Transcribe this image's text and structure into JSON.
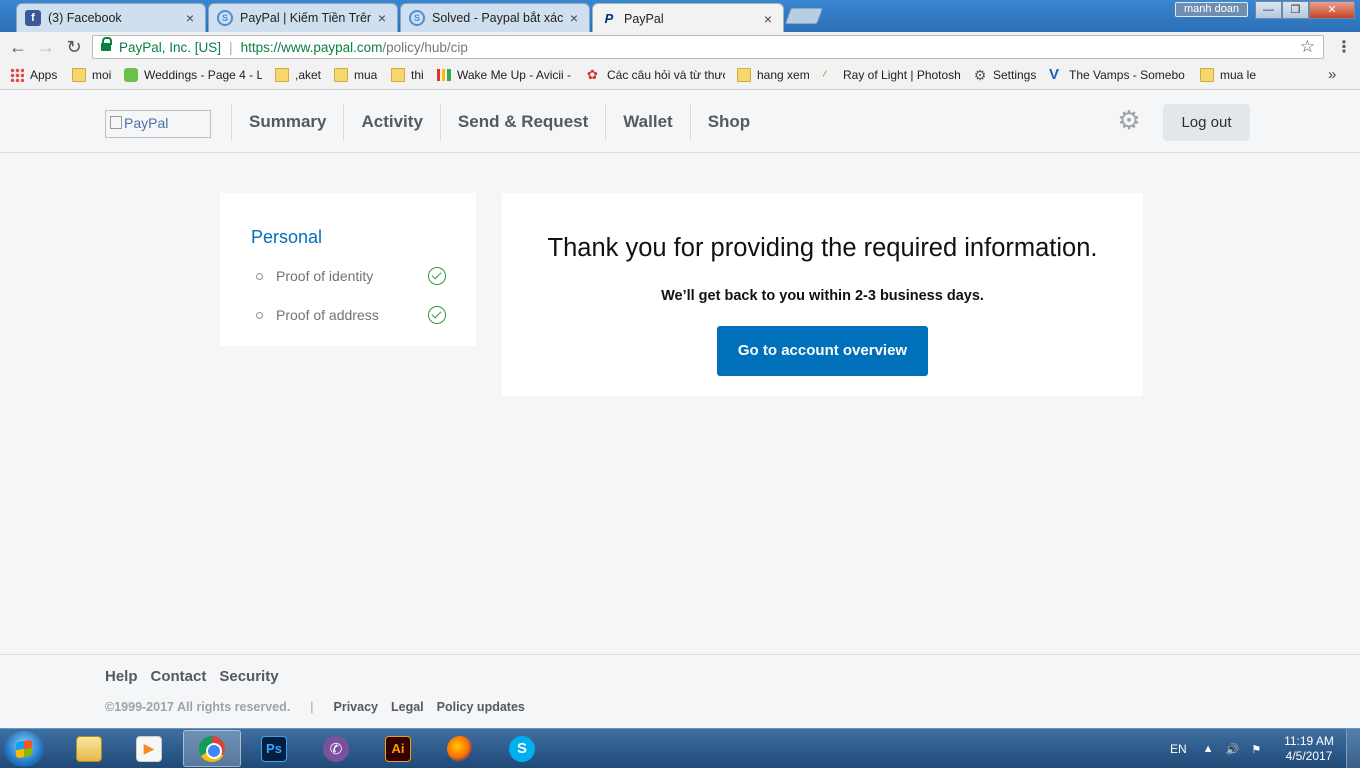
{
  "browser": {
    "tabs": [
      {
        "label": "(3) Facebook",
        "icon": "facebook-icon"
      },
      {
        "label": "PayPal | Kiếm Tiền Trên M",
        "icon": "skype-like-icon"
      },
      {
        "label": "Solved - Paypal bắt xác m",
        "icon": "skype-like-icon"
      },
      {
        "label": "PayPal",
        "icon": "paypal-icon"
      }
    ],
    "user_badge": "manh doan",
    "window_controls": {
      "minimize": "—",
      "restore": "❐",
      "close": "✕"
    },
    "nav": {
      "back": "←",
      "forward": "→",
      "reload": "↻"
    },
    "secure_label": "PayPal, Inc. [US]",
    "url_host": "https://www.paypal.com",
    "url_path": "/policy/hub/cip",
    "bookmarks": [
      {
        "label": "Apps"
      },
      {
        "label": "moi"
      },
      {
        "label": "Weddings - Page 4 - L"
      },
      {
        "label": ",aket"
      },
      {
        "label": "mua"
      },
      {
        "label": "thi"
      },
      {
        "label": "Wake Me Up - Avicii -"
      },
      {
        "label": "Các câu hỏi và từ thươ"
      },
      {
        "label": "hang xem"
      },
      {
        "label": "Ray of Light | Photosh"
      },
      {
        "label": "Settings"
      },
      {
        "label": "The Vamps - Somebo"
      },
      {
        "label": "mua le"
      }
    ],
    "bookmarks_more": "»"
  },
  "paypal": {
    "logo_alt": "PayPal",
    "nav": [
      "Summary",
      "Activity",
      "Send & Request",
      "Wallet",
      "Shop"
    ],
    "logout_label": "Log out",
    "sidebar": {
      "title": "Personal",
      "items": [
        {
          "label": "Proof of identity",
          "status": "complete"
        },
        {
          "label": "Proof of address",
          "status": "complete"
        }
      ]
    },
    "main": {
      "title": "Thank you for providing the required information.",
      "subtitle": "We’ll get back to you within 2-3 business days.",
      "button_label": "Go to account overview"
    },
    "footer": {
      "links": [
        "Help",
        "Contact",
        "Security"
      ],
      "copyright": "©1999-2017 All rights reserved.",
      "separator": "|",
      "legal_links": [
        "Privacy",
        "Legal",
        "Policy updates"
      ]
    }
  },
  "taskbar": {
    "apps": [
      "explorer",
      "media-player",
      "chrome",
      "photoshop",
      "viber",
      "illustrator",
      "firefox",
      "skype"
    ],
    "labels": {
      "ps": "Ps",
      "ai": "Ai",
      "media": "▶",
      "viber": "✆",
      "skype": "S"
    },
    "language": "EN",
    "time": "11:19 AM",
    "date": "4/5/2017"
  }
}
